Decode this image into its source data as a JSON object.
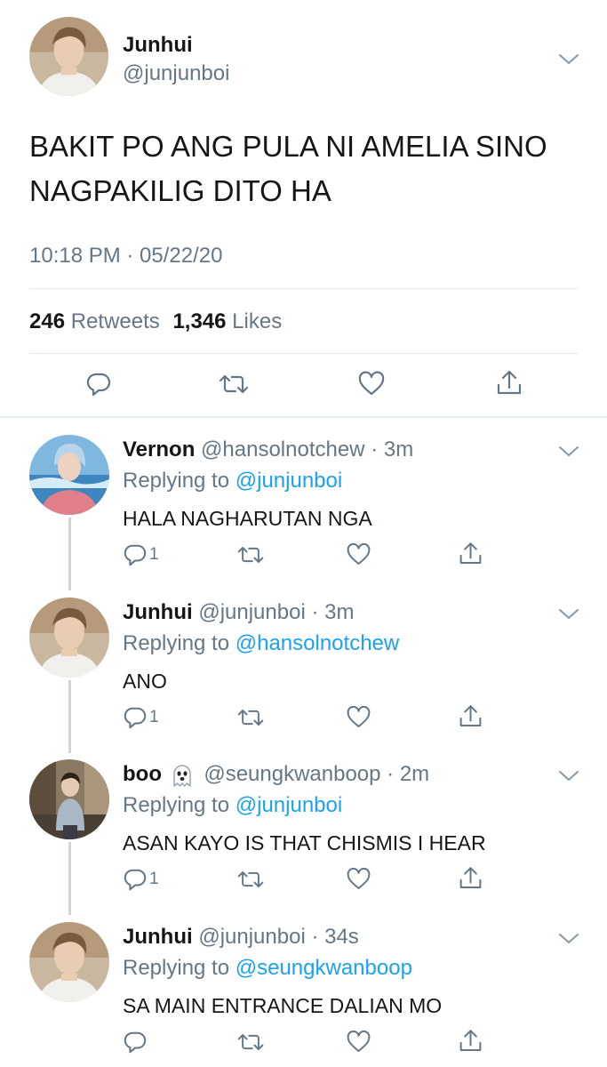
{
  "main_tweet": {
    "name": "Junhui",
    "handle": "@junjunboi",
    "text_line1": "BAKIT PO ANG PULA NI AMELIA SINO",
    "text_line2": "NAGPAKILIG DITO HA",
    "timestamp": "10:18 PM · 05/22/20",
    "retweets_count": "246",
    "retweets_label": "Retweets",
    "likes_count": "1,346",
    "likes_label": "Likes"
  },
  "replies": [
    {
      "name": "Vernon",
      "handle": "@hansolnotchew",
      "time": "· 3m",
      "replying_prefix": "Replying to",
      "replying_to": "@junjunboi",
      "text": "HALA NAGHARUTAN NGA",
      "reply_count": "1"
    },
    {
      "name": "Junhui",
      "handle": "@junjunboi",
      "time": "· 3m",
      "replying_prefix": "Replying to",
      "replying_to": "@hansolnotchew",
      "text": "ANO",
      "reply_count": "1"
    },
    {
      "name": "boo",
      "handle": "@seungkwanboop",
      "time": "· 2m",
      "replying_prefix": "Replying to",
      "replying_to": "@junjunboi",
      "text": "ASAN KAYO IS THAT CHISMIS I HEAR",
      "reply_count": "1"
    },
    {
      "name": "Junhui",
      "handle": "@junjunboi",
      "time": "· 34s",
      "replying_prefix": "Replying to",
      "replying_to": "@seungkwanboop",
      "text": "SA MAIN ENTRANCE DALIAN MO",
      "reply_count": ""
    }
  ],
  "colors": {
    "text": "#14171a",
    "secondary": "#657786",
    "link": "#1da1f2",
    "divider": "#e1e8ed"
  },
  "icons": [
    "chevron-down-icon",
    "reply-icon",
    "retweet-icon",
    "like-icon",
    "share-icon",
    "ghost-emoji"
  ]
}
